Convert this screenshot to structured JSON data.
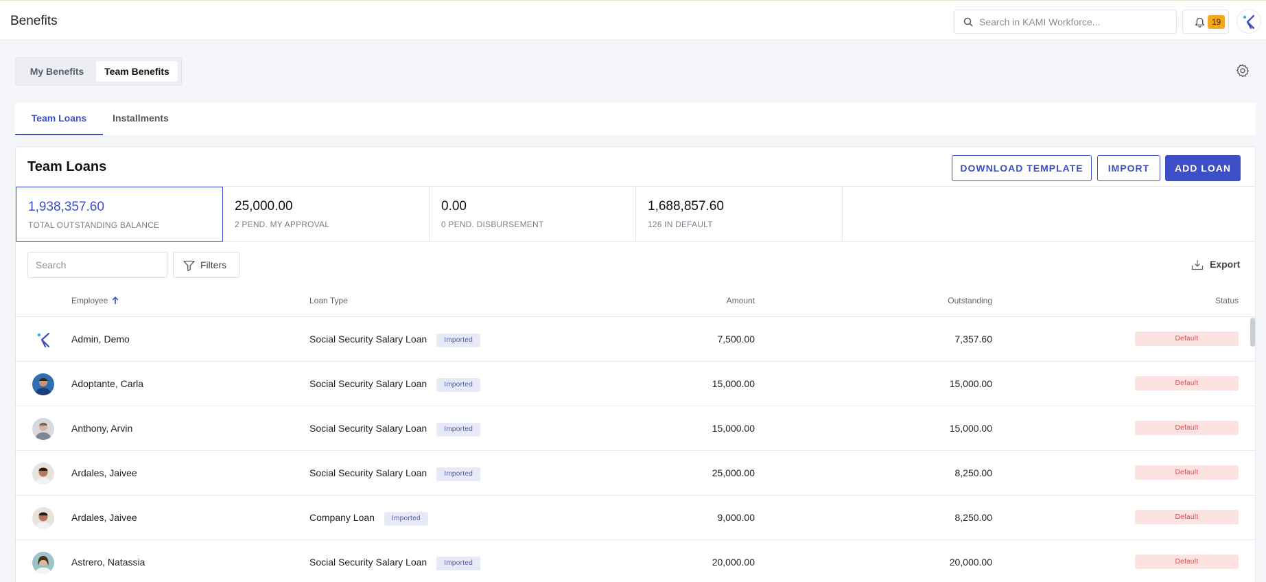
{
  "app": {
    "title": "Benefits",
    "search_placeholder": "Search in KAMI Workforce...",
    "notification_count": "19"
  },
  "benefit_toggle": {
    "my_label": "My Benefits",
    "team_label": "Team Benefits"
  },
  "tabs": [
    {
      "label": "Team Loans"
    },
    {
      "label": "Installments"
    }
  ],
  "card": {
    "title": "Team Loans",
    "download_label": "DOWNLOAD TEMPLATE",
    "import_label": "IMPORT",
    "add_label": "ADD LOAN"
  },
  "stats": [
    {
      "value": "1,938,357.60",
      "label": "TOTAL OUTSTANDING BALANCE"
    },
    {
      "value": "25,000.00",
      "label": "2 PEND. MY APPROVAL"
    },
    {
      "value": "0.00",
      "label": "0 PEND. DISBURSEMENT"
    },
    {
      "value": "1,688,857.60",
      "label": "126 IN DEFAULT"
    }
  ],
  "toolbar": {
    "search_placeholder": "Search",
    "filters_label": "Filters",
    "export_label": "Export"
  },
  "columns": {
    "employee": "Employee",
    "loan_type": "Loan Type",
    "amount": "Amount",
    "outstanding": "Outstanding",
    "status": "Status"
  },
  "rows": [
    {
      "employee": "Admin, Demo",
      "loan_type": "Social Security Salary Loan",
      "tag": "Imported",
      "amount": "7,500.00",
      "outstanding": "7,357.60",
      "status": "Default"
    },
    {
      "employee": "Adoptante, Carla",
      "loan_type": "Social Security Salary Loan",
      "tag": "Imported",
      "amount": "15,000.00",
      "outstanding": "15,000.00",
      "status": "Default"
    },
    {
      "employee": "Anthony, Arvin",
      "loan_type": "Social Security Salary Loan",
      "tag": "Imported",
      "amount": "15,000.00",
      "outstanding": "15,000.00",
      "status": "Default"
    },
    {
      "employee": "Ardales, Jaivee",
      "loan_type": "Social Security Salary Loan",
      "tag": "Imported",
      "amount": "25,000.00",
      "outstanding": "8,250.00",
      "status": "Default"
    },
    {
      "employee": "Ardales, Jaivee",
      "loan_type": "Company Loan",
      "tag": "Imported",
      "amount": "9,000.00",
      "outstanding": "8,250.00",
      "status": "Default"
    },
    {
      "employee": "Astrero, Natassia",
      "loan_type": "Social Security Salary Loan",
      "tag": "Imported",
      "amount": "20,000.00",
      "outstanding": "20,000.00",
      "status": "Default"
    }
  ],
  "colors": {
    "accent": "#3d4fc4",
    "badge": "#f5a623",
    "status_bg": "#fde2e2",
    "status_text": "#e0463f",
    "chip_bg": "#e7e9f7"
  }
}
